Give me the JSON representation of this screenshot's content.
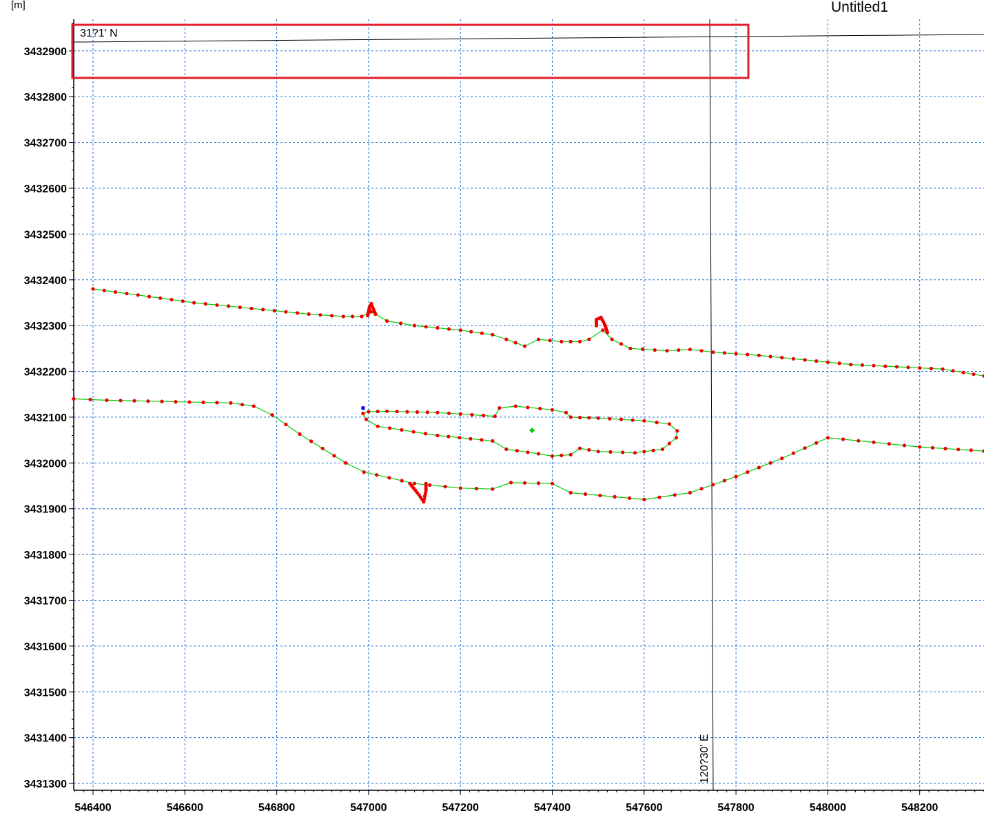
{
  "window": {
    "title": "Untitled1",
    "unit_label": "[m]"
  },
  "map": {
    "x_axis": {
      "range": [
        546358,
        548340
      ],
      "ticks": [
        546400,
        546600,
        546800,
        547000,
        547200,
        547400,
        547600,
        547800,
        548000,
        548200
      ],
      "tick_labels": [
        "546400",
        "546600",
        "546800",
        "547000",
        "547200",
        "547400",
        "547600",
        "547800",
        "548000",
        "548200"
      ]
    },
    "y_axis": {
      "range": [
        3431285,
        3432969
      ],
      "ticks": [
        3431300,
        3431400,
        3431500,
        3431600,
        3431700,
        3431800,
        3431900,
        3432000,
        3432100,
        3432200,
        3432300,
        3432400,
        3432500,
        3432600,
        3432700,
        3432800,
        3432900
      ],
      "tick_labels": [
        "3431300",
        "3431400",
        "3431500",
        "3431600",
        "3431700",
        "3431800",
        "3431900",
        "3432000",
        "3432100",
        "3432200",
        "3432300",
        "3432400",
        "3432500",
        "3432600",
        "3432700",
        "3432800",
        "3432900"
      ]
    },
    "grid": true,
    "graticule": {
      "latitude_label": "31?1' N",
      "longitude_label": "120?30' E"
    },
    "colors": {
      "grid": "#1f6fcf",
      "line": "#00cc00",
      "vertex": "#ee0000",
      "highlight_box": "#e01f2a",
      "graticule": "#000000",
      "start_marker": "#0000ee",
      "center_marker": "#00cc00"
    },
    "north_line": [
      [
        546400,
        3432380
      ],
      [
        546620,
        3432350
      ],
      [
        546870,
        3432325
      ],
      [
        546945,
        3432320
      ],
      [
        546985,
        3432320
      ],
      [
        547005,
        3432330
      ],
      [
        547015,
        3432325
      ],
      [
        547040,
        3432310
      ],
      [
        547100,
        3432300
      ],
      [
        547200,
        3432290
      ],
      [
        547270,
        3432280
      ],
      [
        547300,
        3432270
      ],
      [
        547340,
        3432255
      ],
      [
        547370,
        3432270
      ],
      [
        547420,
        3432265
      ],
      [
        547460,
        3432265
      ],
      [
        547480,
        3432270
      ],
      [
        547510,
        3432290
      ],
      [
        547530,
        3432270
      ],
      [
        547570,
        3432250
      ],
      [
        547650,
        3432245
      ],
      [
        547700,
        3432248
      ],
      [
        547750,
        3432242
      ],
      [
        547850,
        3432235
      ],
      [
        547950,
        3432225
      ],
      [
        548050,
        3432215
      ],
      [
        548150,
        3432210
      ],
      [
        548250,
        3432205
      ],
      [
        548340,
        3432190
      ]
    ],
    "north_spikes": [
      [
        [
          546998,
          3432322
        ],
        [
          547002,
          3432340
        ],
        [
          547006,
          3432348
        ],
        [
          547012,
          3432332
        ],
        [
          547015,
          3432325
        ]
      ],
      [
        [
          547496,
          3432300
        ],
        [
          547496,
          3432313
        ],
        [
          547506,
          3432318
        ],
        [
          547514,
          3432303
        ],
        [
          547520,
          3432285
        ]
      ]
    ],
    "south_line": [
      [
        546358,
        3432140
      ],
      [
        546430,
        3432137
      ],
      [
        546700,
        3432131
      ],
      [
        546750,
        3432124
      ],
      [
        546790,
        3432105
      ],
      [
        546850,
        3432063
      ],
      [
        546950,
        3432000
      ],
      [
        546990,
        3431980
      ],
      [
        547100,
        3431955
      ],
      [
        547200,
        3431945
      ],
      [
        547270,
        3431943
      ],
      [
        547310,
        3431957
      ],
      [
        547400,
        3431955
      ],
      [
        547440,
        3431935
      ],
      [
        547600,
        3431920
      ],
      [
        547700,
        3431935
      ],
      [
        547800,
        3431970
      ],
      [
        547900,
        3432010
      ],
      [
        548000,
        3432055
      ],
      [
        548100,
        3432045
      ],
      [
        548200,
        3432035
      ],
      [
        548340,
        3432026
      ]
    ],
    "south_spike": [
      [
        547090,
        3431955
      ],
      [
        547110,
        3431930
      ],
      [
        547120,
        3431915
      ],
      [
        547125,
        3431940
      ],
      [
        547125,
        3431955
      ]
    ],
    "island_ring": [
      [
        546988,
        3432108
      ],
      [
        547000,
        3432112
      ],
      [
        547040,
        3432113
      ],
      [
        547150,
        3432110
      ],
      [
        547275,
        3432102
      ],
      [
        547285,
        3432120
      ],
      [
        547320,
        3432124
      ],
      [
        547400,
        3432116
      ],
      [
        547430,
        3432110
      ],
      [
        547440,
        3432100
      ],
      [
        547500,
        3432098
      ],
      [
        547600,
        3432092
      ],
      [
        547655,
        3432085
      ],
      [
        547672,
        3432070
      ],
      [
        547670,
        3432055
      ],
      [
        547640,
        3432030
      ],
      [
        547580,
        3432022
      ],
      [
        547500,
        3432025
      ],
      [
        547460,
        3432032
      ],
      [
        547440,
        3432018
      ],
      [
        547400,
        3432015
      ],
      [
        547370,
        3432020
      ],
      [
        547300,
        3432030
      ],
      [
        547270,
        3432048
      ],
      [
        547150,
        3432060
      ],
      [
        547020,
        3432080
      ],
      [
        546995,
        3432095
      ],
      [
        546988,
        3432108
      ]
    ],
    "start_marker": [
      546988,
      3432110
    ],
    "center_marker": [
      547356,
      3432071
    ]
  }
}
